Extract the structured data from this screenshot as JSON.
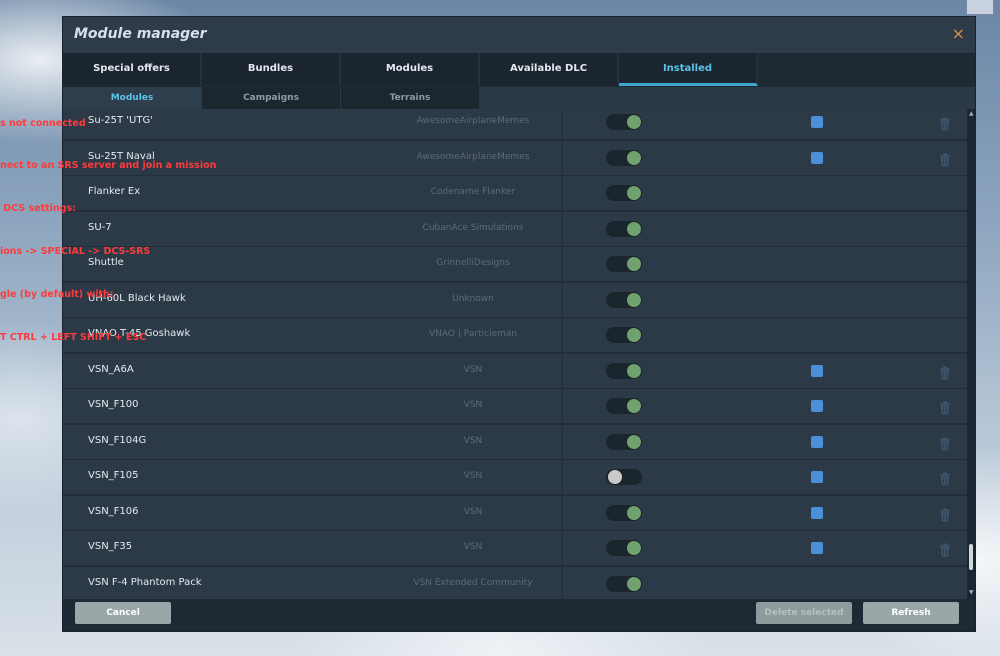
{
  "overlay_lines": [
    "s not connected",
    "nect to an SRS server and join a mission",
    " DCS settings:",
    "ions -> SPECIAL -> DCS-SRS",
    "gle (by default) with:",
    "T CTRL + LEFT SHIFT + ESC"
  ],
  "dialog": {
    "title": "Module manager",
    "close_symbol": "×"
  },
  "tabs": [
    {
      "label": "Special offers",
      "active": false
    },
    {
      "label": "Bundles",
      "active": false
    },
    {
      "label": "Modules",
      "active": false
    },
    {
      "label": "Available DLC",
      "active": false
    },
    {
      "label": "Installed",
      "active": true
    }
  ],
  "subtabs": [
    {
      "label": "Modules",
      "active": true
    },
    {
      "label": "Campaigns",
      "active": false
    },
    {
      "label": "Terrains",
      "active": false
    }
  ],
  "rows": [
    {
      "name": "Su-25T 'UTG'",
      "author": "AwesomeAirplaneMemes",
      "enabled": true,
      "selectable": true
    },
    {
      "name": "Su-25T Naval",
      "author": "AwesomeAirplaneMemes",
      "enabled": true,
      "selectable": true
    },
    {
      "name": "Flanker Ex",
      "author": "Codename Flanker",
      "enabled": true,
      "selectable": false
    },
    {
      "name": "SU-7",
      "author": "CubanAce Simulations",
      "enabled": true,
      "selectable": false
    },
    {
      "name": "Shuttle",
      "author": "GrinnelliDesigns",
      "enabled": true,
      "selectable": false
    },
    {
      "name": "UH-60L Black Hawk",
      "author": "Unknown",
      "enabled": true,
      "selectable": false
    },
    {
      "name": "VNAO T-45 Goshawk",
      "author": "VNAO  |  Particleman",
      "enabled": true,
      "selectable": false
    },
    {
      "name": "VSN_A6A",
      "author": "VSN",
      "enabled": true,
      "selectable": true
    },
    {
      "name": "VSN_F100",
      "author": "VSN",
      "enabled": true,
      "selectable": true
    },
    {
      "name": "VSN_F104G",
      "author": "VSN",
      "enabled": true,
      "selectable": true
    },
    {
      "name": "VSN_F105",
      "author": "VSN",
      "enabled": false,
      "selectable": true
    },
    {
      "name": "VSN_F106",
      "author": "VSN",
      "enabled": true,
      "selectable": true
    },
    {
      "name": "VSN_F35",
      "author": "VSN",
      "enabled": true,
      "selectable": true
    },
    {
      "name": "VSN F-4 Phantom Pack",
      "author": "VSN Extended Community",
      "enabled": true,
      "selectable": false
    }
  ],
  "footer": {
    "cancel_label": "Cancel",
    "delete_label": "Delete selected",
    "refresh_label": "Refresh"
  },
  "colors": {
    "accent": "#5bc3e6",
    "toggle_on": "#6fa26f",
    "checkbox": "#4a90d9",
    "close": "#e08a3c",
    "overlay_text": "#ff3b3b"
  }
}
